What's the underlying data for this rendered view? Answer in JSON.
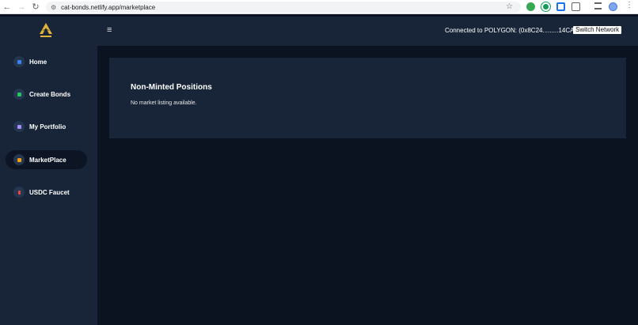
{
  "browser": {
    "url": "cat-bonds.netlify.app/marketplace"
  },
  "header": {
    "connection_status": "Connected to POLYGON: (0x8C24.........14CA)",
    "switch_network_label": "Switch Network"
  },
  "sidebar": {
    "items": [
      {
        "label": "Home",
        "icon": "home-icon",
        "icon_color": "#3b82f6"
      },
      {
        "label": "Create Bonds",
        "icon": "create-bonds-icon",
        "icon_color": "#22c55e"
      },
      {
        "label": "My Portfolio",
        "icon": "portfolio-icon",
        "icon_color": "#a78bfa"
      },
      {
        "label": "MarketPlace",
        "icon": "marketplace-icon",
        "icon_color": "#f59e0b",
        "active": true
      },
      {
        "label": "USDC Faucet",
        "icon": "dollar-icon",
        "icon_color": "#ef4444"
      }
    ]
  },
  "main": {
    "section_title": "Non-Minted Positions",
    "empty_message": "No market listing available."
  },
  "colors": {
    "panel": "#182538",
    "background": "#0b1220",
    "logo_gold": "#e2b33b"
  }
}
